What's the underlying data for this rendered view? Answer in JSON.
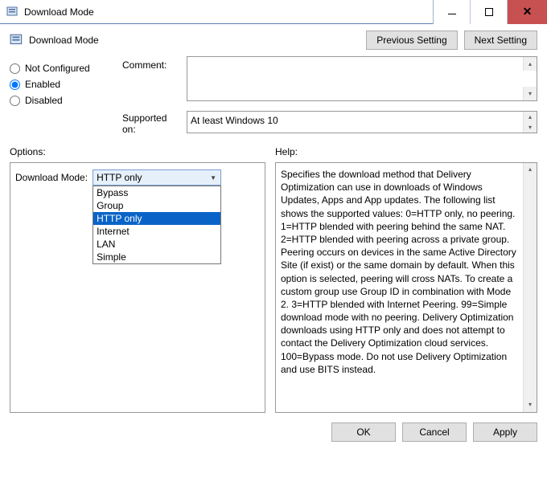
{
  "window": {
    "title": "Download Mode"
  },
  "header": {
    "title": "Download Mode",
    "prev_btn": "Previous Setting",
    "next_btn": "Next Setting"
  },
  "state": {
    "not_configured_label": "Not Configured",
    "enabled_label": "Enabled",
    "disabled_label": "Disabled",
    "selected": "Enabled"
  },
  "comment": {
    "label": "Comment:",
    "value": ""
  },
  "supported": {
    "label": "Supported on:",
    "value": "At least Windows 10"
  },
  "options": {
    "heading": "Options:",
    "download_mode_label": "Download Mode:",
    "selected": "HTTP only",
    "items": [
      "Bypass",
      "Group",
      "HTTP only",
      "Internet",
      "LAN",
      "Simple"
    ]
  },
  "help": {
    "heading": "Help:",
    "text": "Specifies the download method that Delivery Optimization can use in downloads of Windows Updates, Apps and App updates. The following list shows the supported values: 0=HTTP only, no peering. 1=HTTP blended with peering behind the same NAT. 2=HTTP blended with peering across a private group. Peering occurs on devices in the same Active Directory Site (if exist) or the same domain by default. When this option is selected, peering will cross NATs. To create a custom group use Group ID in combination with Mode 2. 3=HTTP blended with Internet Peering. 99=Simple download mode with no peering. Delivery Optimization downloads using HTTP only and does not attempt to contact the Delivery Optimization cloud services. 100=Bypass mode. Do not use Delivery Optimization and use BITS instead."
  },
  "buttons": {
    "ok": "OK",
    "cancel": "Cancel",
    "apply": "Apply"
  }
}
